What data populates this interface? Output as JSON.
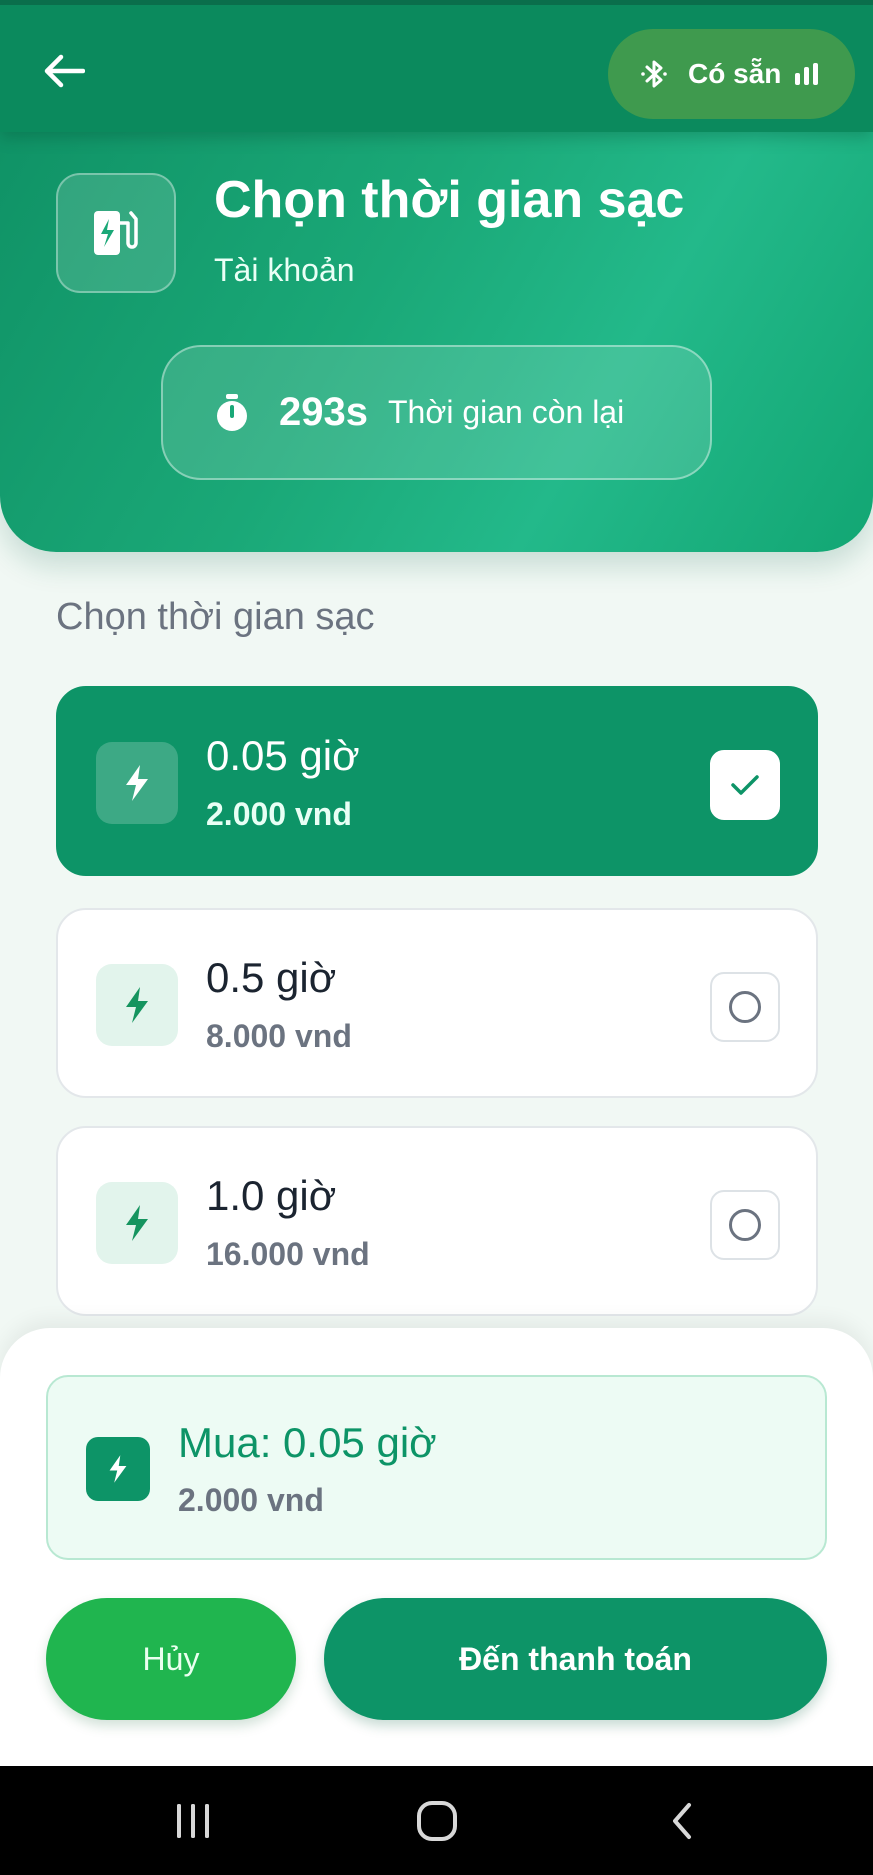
{
  "header": {
    "status_label": "Có sẵn",
    "title": "Chọn thời gian sạc",
    "subtitle": "Tài khoản",
    "timer_value": "293s",
    "timer_label": "Thời gian còn lại"
  },
  "main": {
    "section_title": "Chọn thời gian sạc",
    "options": [
      {
        "hours": "0.05 giờ",
        "price": "2.000 vnd",
        "selected": true
      },
      {
        "hours": "0.5 giờ",
        "price": "8.000 vnd",
        "selected": false
      },
      {
        "hours": "1.0 giờ",
        "price": "16.000 vnd",
        "selected": false
      }
    ]
  },
  "summary": {
    "title": "Mua: 0.05 giờ",
    "price": "2.000 vnd"
  },
  "actions": {
    "cancel_label": "Hủy",
    "pay_label": "Đến thanh toán"
  },
  "icons": {
    "back": "arrow-left-icon",
    "bluetooth": "bluetooth-icon",
    "signal": "signal-icon",
    "charger": "ev-charger-icon",
    "timer": "stopwatch-icon",
    "bolt": "lightning-icon",
    "check": "checkmark-icon"
  },
  "colors": {
    "primary": "#0d9467",
    "accent_green": "#20b54f",
    "status_pill": "#3f9a4e"
  }
}
